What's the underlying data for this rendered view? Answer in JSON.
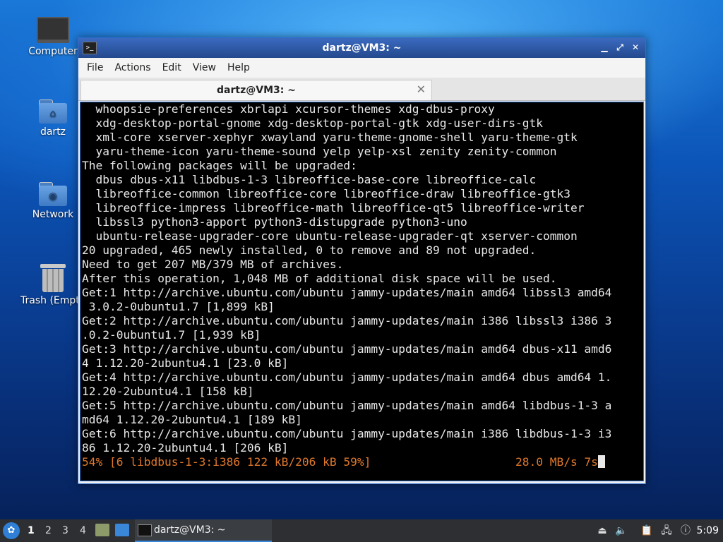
{
  "desktop": {
    "icons": [
      {
        "label": "Computer",
        "icon": "computer-icon"
      },
      {
        "label": "dartz",
        "icon": "home-folder-icon"
      },
      {
        "label": "Network",
        "icon": "network-folder-icon"
      },
      {
        "label": "Trash (Empty)",
        "icon": "trash-icon"
      }
    ]
  },
  "window": {
    "title": "dartz@VM3: ~",
    "controls": {
      "minimize": "▁",
      "maximize": "⤢",
      "close": "✕"
    },
    "menu": [
      "File",
      "Actions",
      "Edit",
      "View",
      "Help"
    ],
    "tab": {
      "title": "dartz@VM3: ~",
      "close": "✕"
    }
  },
  "terminal": {
    "lines": [
      "  whoopsie-preferences xbrlapi xcursor-themes xdg-dbus-proxy",
      "  xdg-desktop-portal-gnome xdg-desktop-portal-gtk xdg-user-dirs-gtk",
      "  xml-core xserver-xephyr xwayland yaru-theme-gnome-shell yaru-theme-gtk",
      "  yaru-theme-icon yaru-theme-sound yelp yelp-xsl zenity zenity-common",
      "The following packages will be upgraded:",
      "  dbus dbus-x11 libdbus-1-3 libreoffice-base-core libreoffice-calc",
      "  libreoffice-common libreoffice-core libreoffice-draw libreoffice-gtk3",
      "  libreoffice-impress libreoffice-math libreoffice-qt5 libreoffice-writer",
      "  libssl3 python3-apport python3-distupgrade python3-uno",
      "  ubuntu-release-upgrader-core ubuntu-release-upgrader-qt xserver-common",
      "20 upgraded, 465 newly installed, 0 to remove and 89 not upgraded.",
      "Need to get 207 MB/379 MB of archives.",
      "After this operation, 1,048 MB of additional disk space will be used.",
      "Get:1 http://archive.ubuntu.com/ubuntu jammy-updates/main amd64 libssl3 amd64",
      " 3.0.2-0ubuntu1.7 [1,899 kB]",
      "Get:2 http://archive.ubuntu.com/ubuntu jammy-updates/main i386 libssl3 i386 3",
      ".0.2-0ubuntu1.7 [1,939 kB]",
      "Get:3 http://archive.ubuntu.com/ubuntu jammy-updates/main amd64 dbus-x11 amd6",
      "4 1.12.20-2ubuntu4.1 [23.0 kB]",
      "Get:4 http://archive.ubuntu.com/ubuntu jammy-updates/main amd64 dbus amd64 1.",
      "12.20-2ubuntu4.1 [158 kB]",
      "Get:5 http://archive.ubuntu.com/ubuntu jammy-updates/main amd64 libdbus-1-3 a",
      "md64 1.12.20-2ubuntu4.1 [189 kB]",
      "Get:6 http://archive.ubuntu.com/ubuntu jammy-updates/main i386 libdbus-1-3 i3",
      "86 1.12.20-2ubuntu4.1 [206 kB]"
    ],
    "progress_line": "54% [6 libdbus-1-3:i386 122 kB/206 kB 59%]                     28.0 MB/s 7s",
    "progress_color": "#e0782c"
  },
  "taskbar": {
    "workspaces": [
      "1",
      "2",
      "3",
      "4"
    ],
    "active_workspace": "1",
    "task_title": "dartz@VM3: ~",
    "tray_icons": [
      "upload-icon",
      "volume-icon",
      "clipboard-icon",
      "network-icon",
      "update-notifier-icon"
    ],
    "clock": "5:09"
  }
}
